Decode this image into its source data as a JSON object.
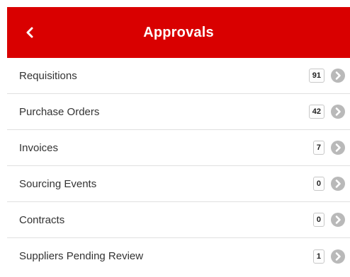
{
  "header": {
    "title": "Approvals",
    "back_icon": "back-chevron-icon",
    "background_color": "#d90000"
  },
  "items": [
    {
      "label": "Requisitions",
      "count": "91",
      "icon": "chevron-right-circle-icon"
    },
    {
      "label": "Purchase Orders",
      "count": "42",
      "icon": "chevron-right-circle-icon"
    },
    {
      "label": "Invoices",
      "count": "7",
      "icon": "chevron-right-circle-icon"
    },
    {
      "label": "Sourcing Events",
      "count": "0",
      "icon": "chevron-right-circle-icon"
    },
    {
      "label": "Contracts",
      "count": "0",
      "icon": "chevron-right-circle-icon"
    },
    {
      "label": "Suppliers Pending Review",
      "count": "1",
      "icon": "chevron-right-circle-icon"
    }
  ]
}
